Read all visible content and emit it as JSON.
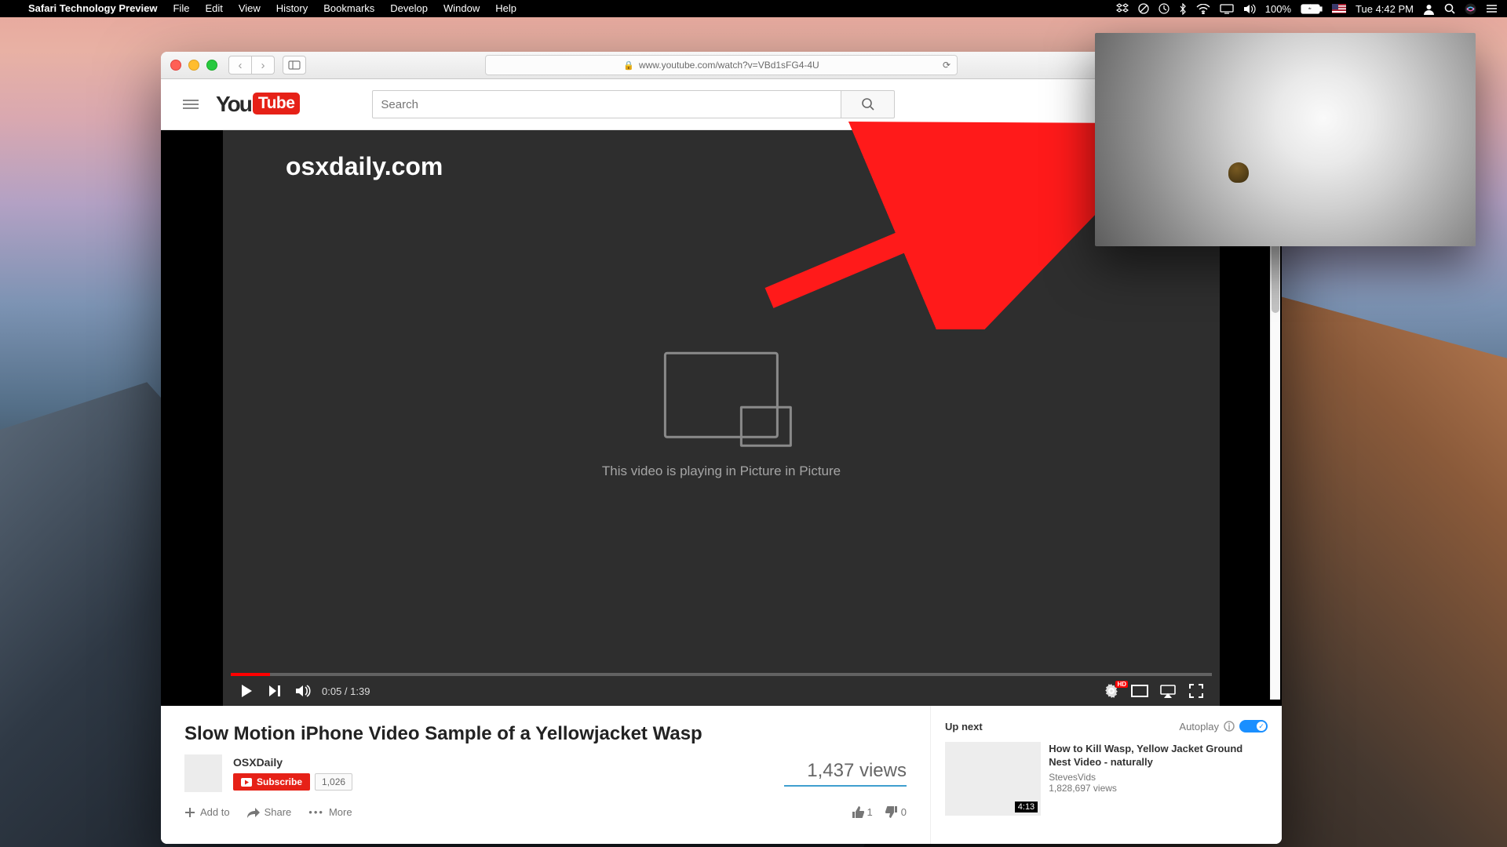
{
  "menubar": {
    "app_name": "Safari Technology Preview",
    "items": [
      "File",
      "Edit",
      "View",
      "History",
      "Bookmarks",
      "Develop",
      "Window",
      "Help"
    ],
    "battery_text": "100%",
    "clock": "Tue 4:42 PM"
  },
  "safari": {
    "url_display": "www.youtube.com/watch?v=VBd1sFG4-4U"
  },
  "youtube": {
    "search_placeholder": "Search",
    "watermark": "osxdaily.com",
    "pip_message": "This video is playing in Picture in Picture",
    "timecode": "0:05 / 1:39",
    "hd_badge": "HD",
    "video": {
      "title": "Slow Motion iPhone Video Sample of a Yellowjacket Wasp",
      "channel": "OSXDaily",
      "subscribe_label": "Subscribe",
      "subscriber_count": "1,026",
      "views_text": "1,437 views",
      "add_to_label": "Add to",
      "share_label": "Share",
      "more_label": "More",
      "likes": "1",
      "dislikes": "0"
    },
    "sidebar": {
      "up_next_label": "Up next",
      "autoplay_label": "Autoplay",
      "rec_title": "How to Kill Wasp, Yellow Jacket Ground Nest Video - naturally",
      "rec_channel": "StevesVids",
      "rec_views": "1,828,697 views",
      "rec_duration": "4:13"
    }
  }
}
